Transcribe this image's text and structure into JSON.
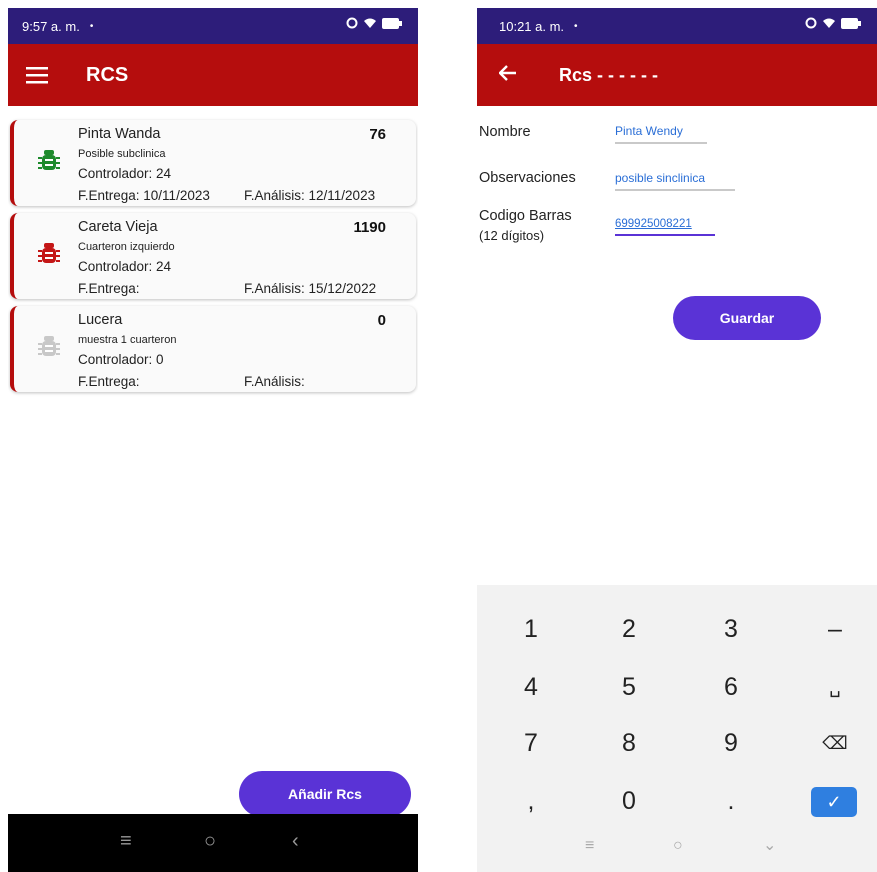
{
  "left_screen": {
    "status": {
      "time": "9:57 a. m.",
      "dot": "•"
    },
    "appbar": {
      "title": "RCS"
    },
    "items": [
      {
        "name": "Pinta Wanda",
        "subtitle": "Posible subclinica",
        "controller": "Controlador: 24",
        "delivery": "F.Entrega: 10/11/2023",
        "analysis": "F.Análisis: 12/11/2023",
        "count": "76",
        "bug_color": "#1e8a2c"
      },
      {
        "name": "Careta Vieja",
        "subtitle": "Cuarteron izquierdo",
        "controller": "Controlador: 24",
        "delivery": "F.Entrega:",
        "analysis": "F.Análisis: 15/12/2022",
        "count": "1190",
        "bug_color": "#c41616"
      },
      {
        "name": "Lucera",
        "subtitle": "muestra 1 cuarteron",
        "controller": "Controlador: 0",
        "delivery": "F.Entrega:",
        "analysis": "F.Análisis:",
        "count": "0",
        "bug_color": "#c8c8c8"
      }
    ],
    "fab": {
      "label": "Añadir Rcs"
    }
  },
  "right_screen": {
    "status": {
      "time": "10:21 a. m.",
      "dot": "•"
    },
    "appbar": {
      "title": "Rcs - - - - - -"
    },
    "form": {
      "name_label": "Nombre",
      "name_value": "Pinta Wendy",
      "obs_label": "Observaciones",
      "obs_value": "posible sinclinica",
      "barcode_label_1": "Codigo Barras",
      "barcode_label_2": "(12 dígitos)",
      "barcode_value": "699925008221"
    },
    "save_label": "Guardar",
    "keyboard": {
      "rows": [
        [
          "1",
          "2",
          "3",
          "–"
        ],
        [
          "4",
          "5",
          "6",
          "␣"
        ],
        [
          "7",
          "8",
          "9",
          "⌫"
        ],
        [
          ",",
          "0",
          ".",
          "✓"
        ]
      ]
    }
  },
  "colors": {
    "status_bar": "#2d1d7a",
    "app_bar": "#b50d0d",
    "accent": "#5a33d6",
    "link": "#2a6ed6"
  }
}
